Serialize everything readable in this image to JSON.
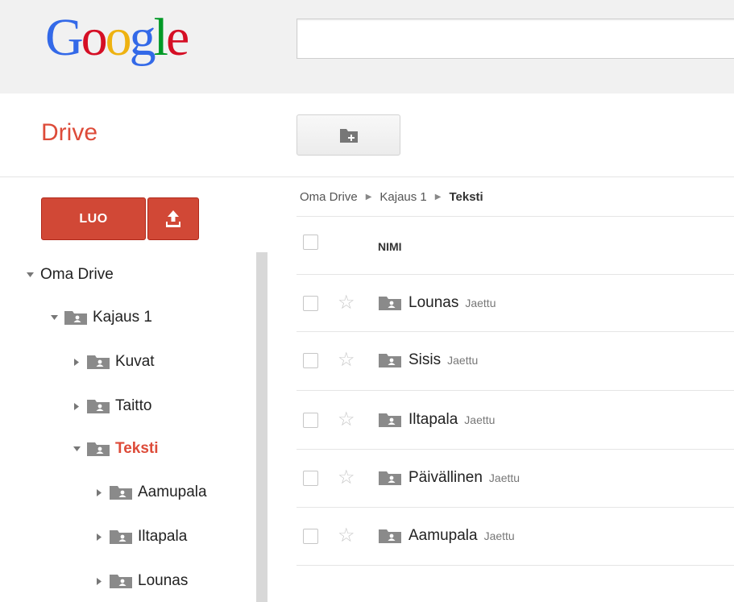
{
  "header": {
    "logo_letters": [
      "G",
      "o",
      "o",
      "g",
      "l",
      "e"
    ],
    "logo_colors": [
      "#3369e8",
      "#d50f25",
      "#eeb211",
      "#3369e8",
      "#009925",
      "#d50f25"
    ],
    "search_placeholder": ""
  },
  "app": {
    "title": "Drive",
    "accent_color": "#dd4b39",
    "create_label": "LUO",
    "upload_icon": "upload-icon",
    "new_folder_icon": "new-folder-icon"
  },
  "sidebar": {
    "tree": [
      {
        "label": "Oma Drive",
        "level": 0,
        "expanded": true,
        "folder": false,
        "active": false
      },
      {
        "label": "Kajaus 1",
        "level": 1,
        "expanded": true,
        "folder": true,
        "active": false
      },
      {
        "label": "Kuvat",
        "level": 2,
        "expanded": false,
        "folder": true,
        "active": false
      },
      {
        "label": "Taitto",
        "level": 2,
        "expanded": false,
        "folder": true,
        "active": false
      },
      {
        "label": "Teksti",
        "level": 2,
        "expanded": true,
        "folder": true,
        "active": true
      },
      {
        "label": "Aamupala",
        "level": 3,
        "expanded": false,
        "folder": true,
        "active": false
      },
      {
        "label": "Iltapala",
        "level": 3,
        "expanded": false,
        "folder": true,
        "active": false
      },
      {
        "label": "Lounas",
        "level": 3,
        "expanded": false,
        "folder": true,
        "active": false
      }
    ]
  },
  "main": {
    "breadcrumb": [
      "Oma Drive",
      "Kajaus 1",
      "Teksti"
    ],
    "column_name": "NIMI",
    "files": [
      {
        "name": "Lounas",
        "badge": "Jaettu"
      },
      {
        "name": "Sisis",
        "badge": "Jaettu"
      },
      {
        "name": "Iltapala",
        "badge": "Jaettu"
      },
      {
        "name": "Päivällinen",
        "badge": "Jaettu"
      },
      {
        "name": "Aamupala",
        "badge": "Jaettu"
      }
    ]
  }
}
